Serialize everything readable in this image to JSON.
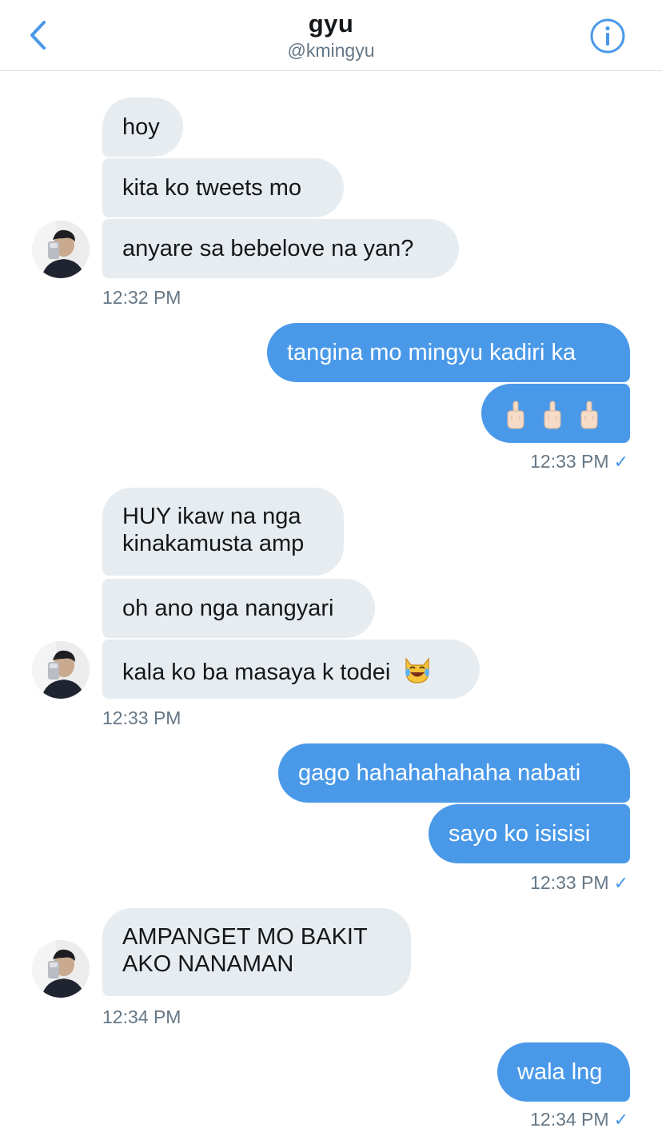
{
  "header": {
    "title": "gyu",
    "handle": "@kmingyu"
  },
  "messages": {
    "m1": "hoy",
    "m2": "kita ko tweets mo",
    "m3": "anyare sa bebelove na yan?",
    "t1": "12:32 PM",
    "m4": "tangina mo mingyu kadiri ka",
    "t2": "12:33 PM",
    "m6": "HUY ikaw na nga kinakamusta amp",
    "m7": "oh ano nga nangyari",
    "m8": "kala ko ba masaya k todei",
    "t3": "12:33 PM",
    "m9": "gago hahahahahaha nabati",
    "m10": "sayo ko isisisi",
    "t4": "12:33 PM",
    "m11": "AMPANGET MO BAKIT AKO NANAMAN",
    "t5": "12:34 PM",
    "m12": "wala lng",
    "t6": "12:34 PM"
  },
  "icons": {
    "back": "chevron-left-icon",
    "info": "info-icon",
    "read": "checkmark-icon",
    "emoji_finger": "middle-finger-emoji",
    "emoji_cat": "cat-tears-of-joy-emoji"
  },
  "colors": {
    "accent": "#4a99e9",
    "received_bubble": "#e6ecf0",
    "secondary_text": "#657786"
  }
}
